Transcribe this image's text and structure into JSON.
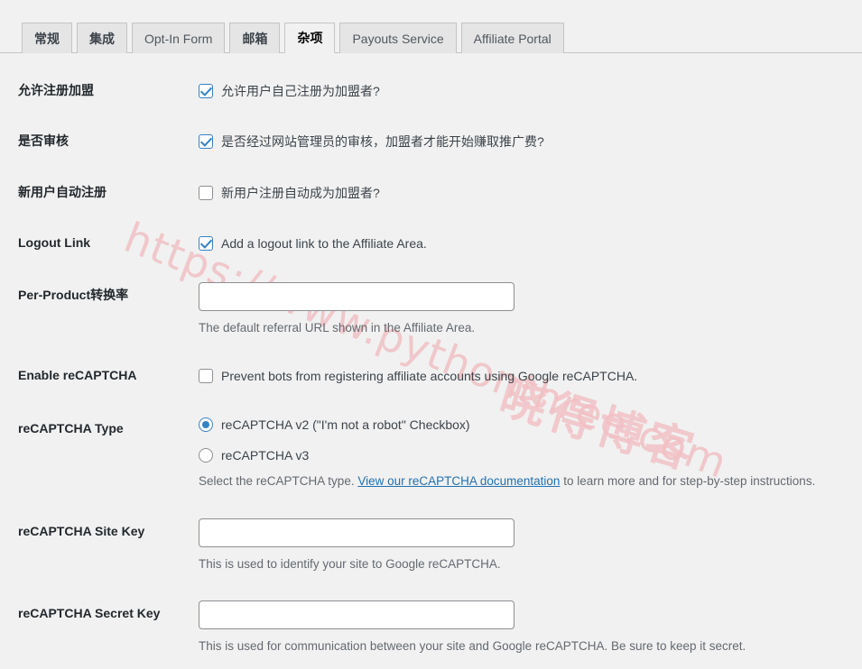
{
  "tabs": [
    {
      "label": "常规",
      "active": false,
      "cjk": true
    },
    {
      "label": "集成",
      "active": false,
      "cjk": true
    },
    {
      "label": "Opt-In Form",
      "active": false,
      "cjk": false
    },
    {
      "label": "邮箱",
      "active": false,
      "cjk": true
    },
    {
      "label": "杂项",
      "active": true,
      "cjk": true
    },
    {
      "label": "Payouts Service",
      "active": false,
      "cjk": false
    },
    {
      "label": "Affiliate Portal",
      "active": false,
      "cjk": false
    }
  ],
  "rows": {
    "allow_registration": {
      "label": "允许注册加盟",
      "checkbox_label": "允许用户自己注册为加盟者?",
      "checked": true
    },
    "require_approval": {
      "label": "是否审核",
      "checkbox_label": "是否经过网站管理员的审核，加盟者才能开始赚取推广费?",
      "checked": true
    },
    "auto_register": {
      "label": "新用户自动注册",
      "checkbox_label": "新用户注册自动成为加盟者?",
      "checked": false
    },
    "logout_link": {
      "label": "Logout Link",
      "checkbox_label": "Add a logout link to the Affiliate Area.",
      "checked": true
    },
    "per_product_rate": {
      "label": "Per-Product转换率",
      "value": "",
      "placeholder": "",
      "description": "The default referral URL shown in the Affiliate Area."
    },
    "enable_recaptcha": {
      "label": "Enable reCAPTCHA",
      "checkbox_label": "Prevent bots from registering affiliate accounts using Google reCAPTCHA.",
      "checked": false
    },
    "recaptcha_type": {
      "label": "reCAPTCHA Type",
      "options": [
        {
          "label": "reCAPTCHA v2 (\"I'm not a robot\" Checkbox)",
          "selected": true
        },
        {
          "label": "reCAPTCHA v3",
          "selected": false
        }
      ],
      "description_before": "Select the reCAPTCHA type. ",
      "description_link": "View our reCAPTCHA documentation",
      "description_after": " to learn more and for step-by-step instructions."
    },
    "recaptcha_site_key": {
      "label": "reCAPTCHA Site Key",
      "value": "",
      "placeholder": "",
      "description": "This is used to identify your site to Google reCAPTCHA."
    },
    "recaptcha_secret_key": {
      "label": "reCAPTCHA Secret Key",
      "value": "",
      "placeholder": "",
      "description": "This is used for communication between your site and Google reCAPTCHA. Be sure to keep it secret."
    }
  },
  "watermark": {
    "url_text": "https://www.pythonthree.com",
    "cn_text": "晓得博客",
    "color": "#f0b9bd"
  },
  "colors": {
    "background": "#f1f1f1",
    "accent": "#3582c4",
    "link": "#2271b1",
    "label": "#23282d",
    "description": "#646970",
    "tab_inactive_bg": "#e5e5e5",
    "border": "#c3c4c7"
  }
}
